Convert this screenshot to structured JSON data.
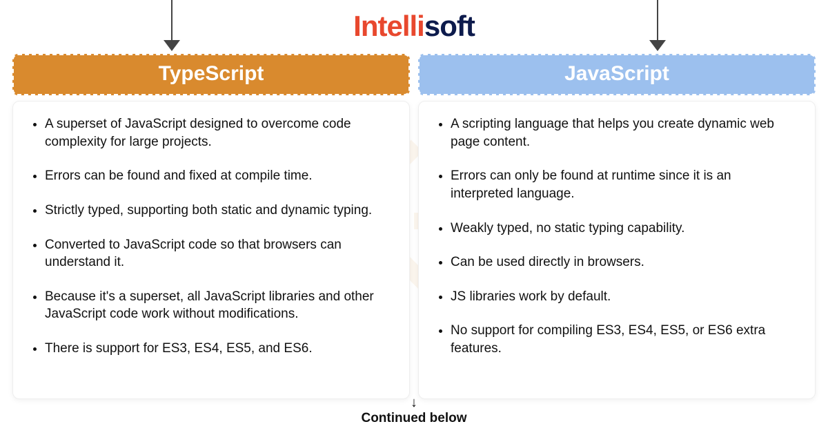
{
  "brand": {
    "part1": "Intelli",
    "part2": "soft"
  },
  "columns": {
    "left": {
      "title": "TypeScript",
      "color": "#d98a2e",
      "points": [
        "A superset of JavaScript designed to overcome code complexity for large projects.",
        "Errors can be found and fixed at compile time.",
        "Strictly typed, supporting both static and dynamic typing.",
        "Converted to JavaScript code so that browsers can understand it.",
        "Because it's a superset, all JavaScript libraries and other JavaScript code work without modifications.",
        "There is support for ES3, ES4, ES5, and ES6."
      ]
    },
    "right": {
      "title": "JavaScript",
      "color": "#9cc0ee",
      "points": [
        "A scripting language that helps you create dynamic web page content.",
        "Errors can only be found at runtime since it is an interpreted language.",
        "Weakly typed, no static typing capability.",
        "Can be used directly in browsers.",
        "JS libraries work by default.",
        "No support for compiling ES3, ES4, ES5, or ES6 extra features."
      ]
    }
  },
  "footer": {
    "arrow": "↓",
    "text": "Continued below"
  }
}
